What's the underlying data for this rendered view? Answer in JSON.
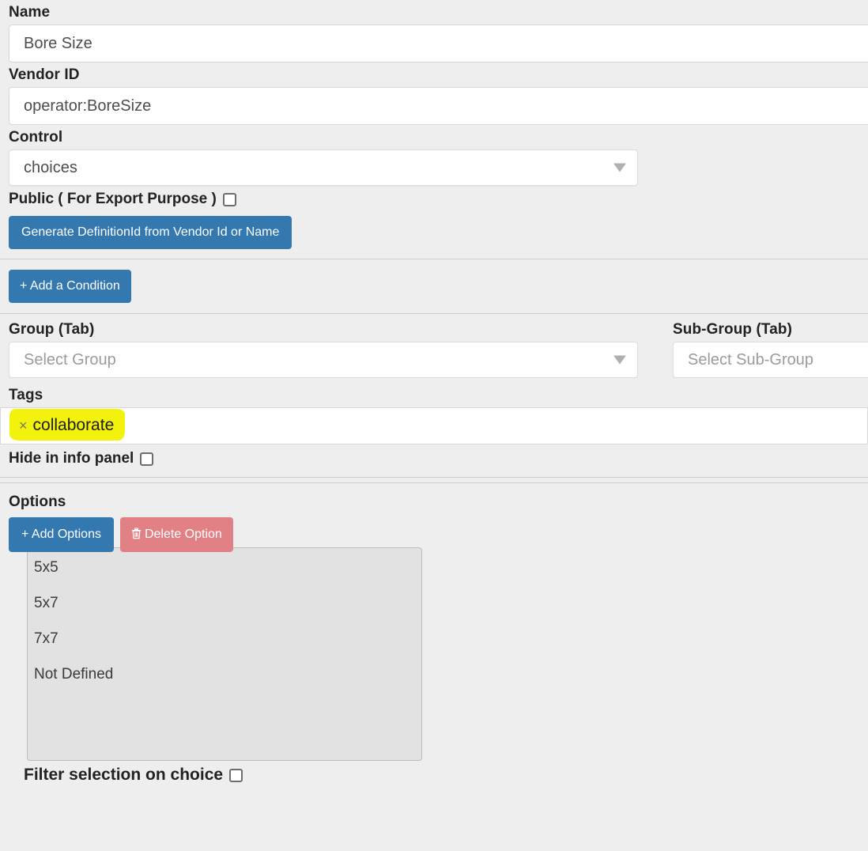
{
  "form": {
    "name": {
      "label": "Name",
      "value": "Bore Size"
    },
    "vendor_id": {
      "label": "Vendor ID",
      "value": "operator:BoreSize"
    },
    "control": {
      "label": "Control",
      "value": "choices"
    },
    "public_export": {
      "label": "Public ( For Export Purpose )",
      "checked": false
    },
    "generate_button": {
      "label": "Generate DefinitionId from Vendor Id or Name"
    },
    "add_condition_button": {
      "label": "+ Add a Condition"
    },
    "group": {
      "label": "Group (Tab)",
      "placeholder": "Select Group",
      "value": ""
    },
    "sub_group": {
      "label": "Sub-Group (Tab)",
      "placeholder": "Select Sub-Group",
      "value": ""
    },
    "tags": {
      "label": "Tags",
      "chips": [
        {
          "remove_glyph": "×",
          "text": "collaborate",
          "highlight_color": "#f2f20c"
        }
      ]
    },
    "hide_in_info_panel": {
      "label": "Hide in info panel",
      "checked": false
    },
    "options": {
      "label": "Options",
      "add_button": "+ Add Options",
      "delete_button": "Delete Option",
      "delete_icon_glyph": "🗑",
      "items": [
        "5x5",
        "5x7",
        "7x7",
        "Not Defined"
      ]
    },
    "filter_selection": {
      "label": "Filter selection on choice",
      "checked": false
    }
  },
  "theme": {
    "primary": "#3478b0",
    "danger": "#e28185",
    "page_bg": "#eeeeee",
    "input_bg": "#ffffff",
    "listbox_bg": "#e2e2e2"
  }
}
